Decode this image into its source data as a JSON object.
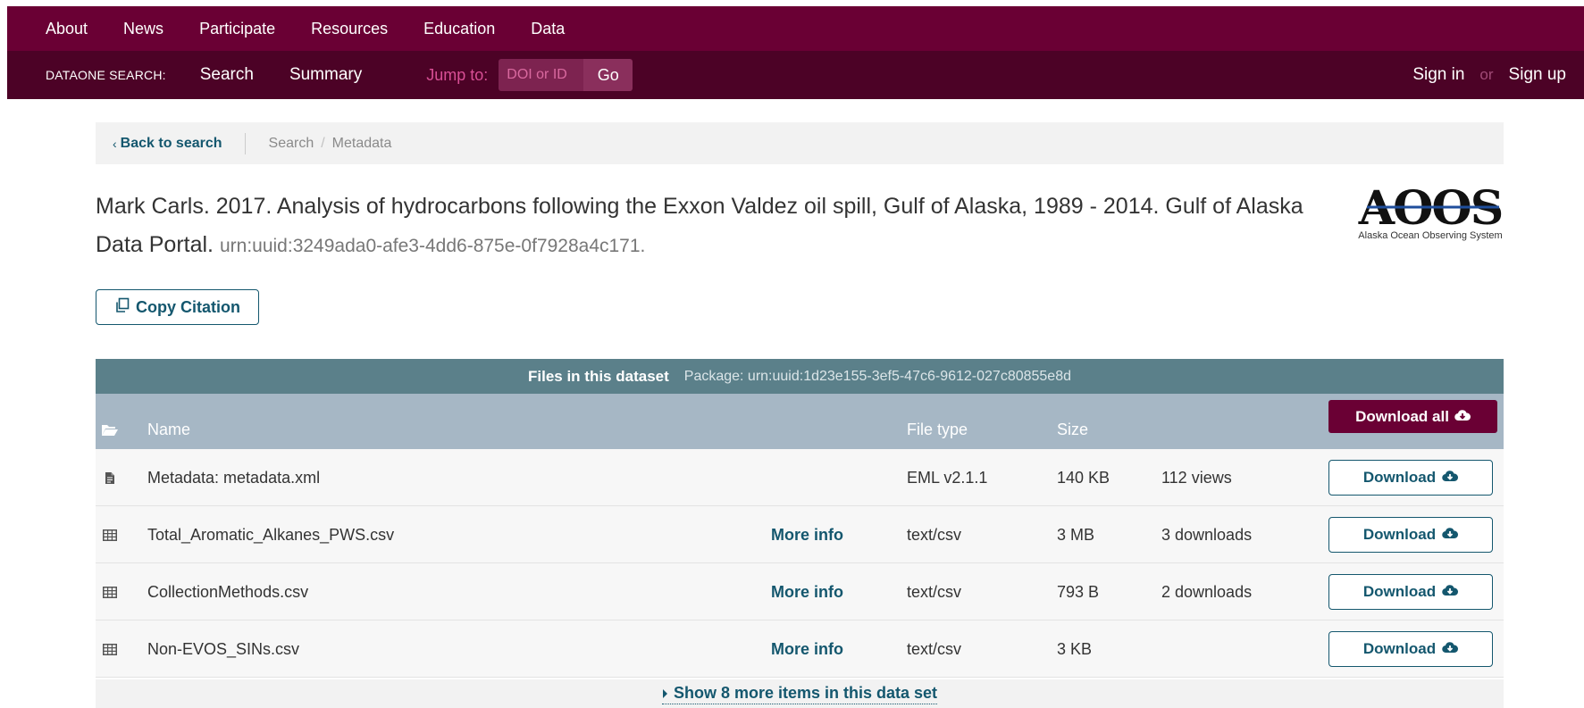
{
  "topnav": {
    "items": [
      "About",
      "News",
      "Participate",
      "Resources",
      "Education",
      "Data"
    ]
  },
  "subnav": {
    "brand": "DATAONE SEARCH:",
    "links": [
      "Search",
      "Summary"
    ],
    "jump_label": "Jump to:",
    "jump_placeholder": "DOI or ID",
    "go_label": "Go",
    "sign_in": "Sign in",
    "or": "or",
    "sign_up": "Sign up"
  },
  "breadcrumb": {
    "back_label": "Back to search",
    "items": [
      "Search",
      "Metadata"
    ],
    "separator": "/"
  },
  "citation": {
    "text": "Mark Carls. 2017. Analysis of hydrocarbons following the Exxon Valdez oil spill, Gulf of Alaska, 1989 - 2014. Gulf of Alaska Data Portal.",
    "identifier": "urn:uuid:3249ada0-afe3-4dd6-875e-0f7928a4c171."
  },
  "logo": {
    "mark": "AOOS",
    "subtitle": "Alaska Ocean Observing System"
  },
  "copy_citation_label": "Copy Citation",
  "files": {
    "title": "Files in this dataset",
    "package": "Package: urn:uuid:1d23e155-3ef5-47c6-9612-027c80855e8d",
    "columns": {
      "name": "Name",
      "file_type": "File type",
      "size": "Size"
    },
    "download_all_label": "Download all",
    "download_label": "Download",
    "more_info_label": "More info",
    "rows": [
      {
        "icon": "document-icon",
        "name": "Metadata: metadata.xml",
        "more_info": "",
        "file_type": "EML v2.1.1",
        "size": "140 KB",
        "stat": "112 views"
      },
      {
        "icon": "table-icon",
        "name": "Total_Aromatic_Alkanes_PWS.csv",
        "more_info": "More info",
        "file_type": "text/csv",
        "size": "3 MB",
        "stat": "3 downloads"
      },
      {
        "icon": "table-icon",
        "name": "CollectionMethods.csv",
        "more_info": "More info",
        "file_type": "text/csv",
        "size": "793 B",
        "stat": "2 downloads"
      },
      {
        "icon": "table-icon",
        "name": "Non-EVOS_SINs.csv",
        "more_info": "More info",
        "file_type": "text/csv",
        "size": "3 KB",
        "stat": ""
      }
    ],
    "show_more_label": "Show 8 more items in this data set"
  },
  "colors": {
    "topnav_bg": "#6a0034",
    "subnav_bg": "#4c0226",
    "accent_teal": "#14576e",
    "files_header_bg": "#5b808a",
    "column_header_bg": "#a6b7c5"
  }
}
